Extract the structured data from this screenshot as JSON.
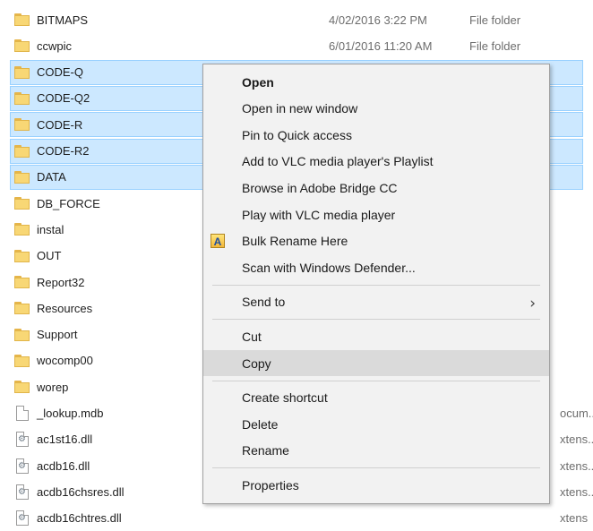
{
  "files": [
    {
      "name": "BITMAPS",
      "kind": "folder",
      "date": "4/02/2016 3:22 PM",
      "type": "File folder",
      "selected": false
    },
    {
      "name": "ccwpic",
      "kind": "folder",
      "date": "6/01/2016 11:20 AM",
      "type": "File folder",
      "selected": false
    },
    {
      "name": "CODE-Q",
      "kind": "folder",
      "selected": true
    },
    {
      "name": "CODE-Q2",
      "kind": "folder",
      "selected": true
    },
    {
      "name": "CODE-R",
      "kind": "folder",
      "selected": true
    },
    {
      "name": "CODE-R2",
      "kind": "folder",
      "selected": true
    },
    {
      "name": "DATA",
      "kind": "folder",
      "selected": true
    },
    {
      "name": "DB_FORCE",
      "kind": "folder",
      "selected": false
    },
    {
      "name": "instal",
      "kind": "folder",
      "selected": false
    },
    {
      "name": "OUT",
      "kind": "folder",
      "selected": false
    },
    {
      "name": "Report32",
      "kind": "folder",
      "selected": false
    },
    {
      "name": "Resources",
      "kind": "folder",
      "selected": false
    },
    {
      "name": "Support",
      "kind": "folder",
      "selected": false
    },
    {
      "name": "wocomp00",
      "kind": "folder",
      "selected": false
    },
    {
      "name": "worep",
      "kind": "folder",
      "selected": false
    },
    {
      "name": "_lookup.mdb",
      "kind": "file",
      "type_fragment": "ocum..",
      "selected": false
    },
    {
      "name": "ac1st16.dll",
      "kind": "dll",
      "type_fragment": "xtens..",
      "selected": false
    },
    {
      "name": "acdb16.dll",
      "kind": "dll",
      "type_fragment": "xtens..",
      "selected": false
    },
    {
      "name": "acdb16chsres.dll",
      "kind": "dll",
      "type_fragment": "xtens..",
      "selected": false
    },
    {
      "name": "acdb16chtres.dll",
      "kind": "dll",
      "type_fragment": "xtens",
      "selected": false
    }
  ],
  "context_menu": {
    "items": [
      {
        "label": "Open",
        "bold": true
      },
      {
        "label": "Open in new window"
      },
      {
        "label": "Pin to Quick access"
      },
      {
        "label": "Add to VLC media player's Playlist"
      },
      {
        "label": "Browse in Adobe Bridge CC"
      },
      {
        "label": "Play with VLC media player"
      },
      {
        "label": "Bulk Rename Here",
        "icon": "bulk-rename-icon",
        "icon_glyph": "A"
      },
      {
        "label": "Scan with Windows Defender..."
      },
      {
        "separator": true
      },
      {
        "label": "Send to",
        "submenu": true
      },
      {
        "separator": true
      },
      {
        "label": "Cut"
      },
      {
        "label": "Copy",
        "hover": true
      },
      {
        "separator": true
      },
      {
        "label": "Create shortcut"
      },
      {
        "label": "Delete"
      },
      {
        "label": "Rename"
      },
      {
        "separator": true
      },
      {
        "label": "Properties"
      }
    ]
  },
  "colors": {
    "selection_background": "#cce8ff",
    "selection_border": "#99d1ff",
    "menu_background": "#f2f2f2",
    "menu_hover": "#dadada",
    "folder": "#f8d775"
  }
}
